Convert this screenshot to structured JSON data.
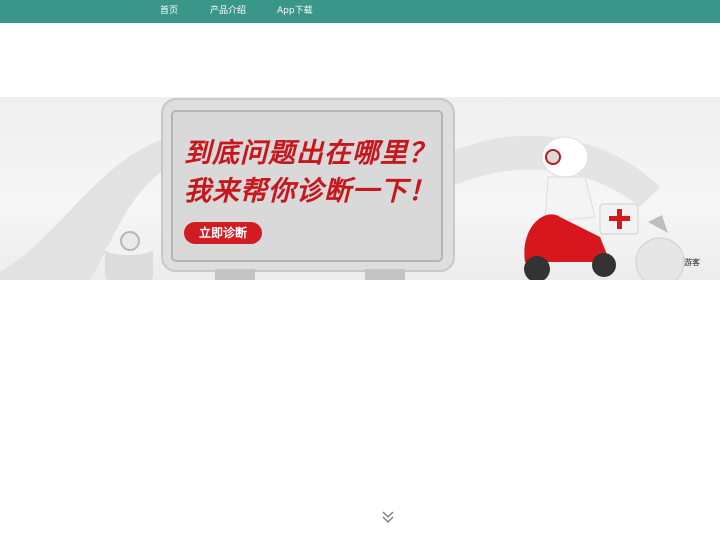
{
  "nav": {
    "items": [
      {
        "label": "首页"
      },
      {
        "label": "产品介绍"
      },
      {
        "label": "App下载"
      }
    ]
  },
  "banner": {
    "line1": "到底问题出在哪里？",
    "line2": "我来帮你诊断一下！",
    "button_label": "立即诊断",
    "guest_label": "游客"
  },
  "colors": {
    "nav_bg": "#3a9688",
    "accent_red": "#c8161d",
    "button_red": "#d11c22"
  },
  "icons": {
    "scroll": "double-chevron-down-icon"
  }
}
